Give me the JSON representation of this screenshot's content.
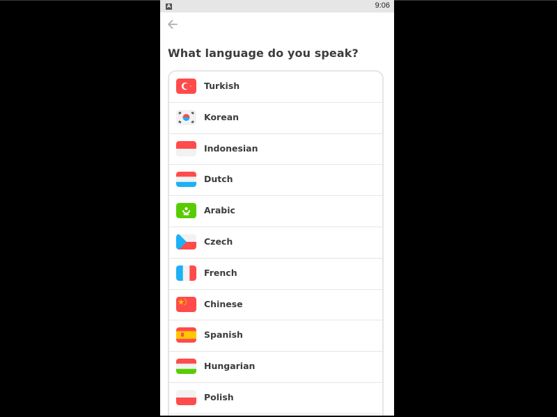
{
  "status_bar": {
    "time": "9:06",
    "app_icon_letter": "A"
  },
  "header": {
    "back_icon": "arrow-left-icon",
    "title": "What language do you speak?"
  },
  "languages": [
    {
      "label": "Turkish",
      "flag": "turkey-flag-icon"
    },
    {
      "label": "Korean",
      "flag": "south-korea-flag-icon"
    },
    {
      "label": "Indonesian",
      "flag": "indonesia-flag-icon"
    },
    {
      "label": "Dutch",
      "flag": "netherlands-flag-icon"
    },
    {
      "label": "Arabic",
      "flag": "arabic-flag-icon"
    },
    {
      "label": "Czech",
      "flag": "czech-flag-icon"
    },
    {
      "label": "French",
      "flag": "france-flag-icon"
    },
    {
      "label": "Chinese",
      "flag": "china-flag-icon"
    },
    {
      "label": "Spanish",
      "flag": "spain-flag-icon"
    },
    {
      "label": "Hungarian",
      "flag": "hungary-flag-icon"
    },
    {
      "label": "Polish",
      "flag": "poland-flag-icon"
    }
  ],
  "colors": {
    "text": "#3c3c3c",
    "border": "#e5e5e5",
    "flag_red": "#ff4b4b",
    "flag_blue": "#1cb0f6",
    "flag_green": "#58cc02",
    "flag_yellow": "#ffc800"
  }
}
